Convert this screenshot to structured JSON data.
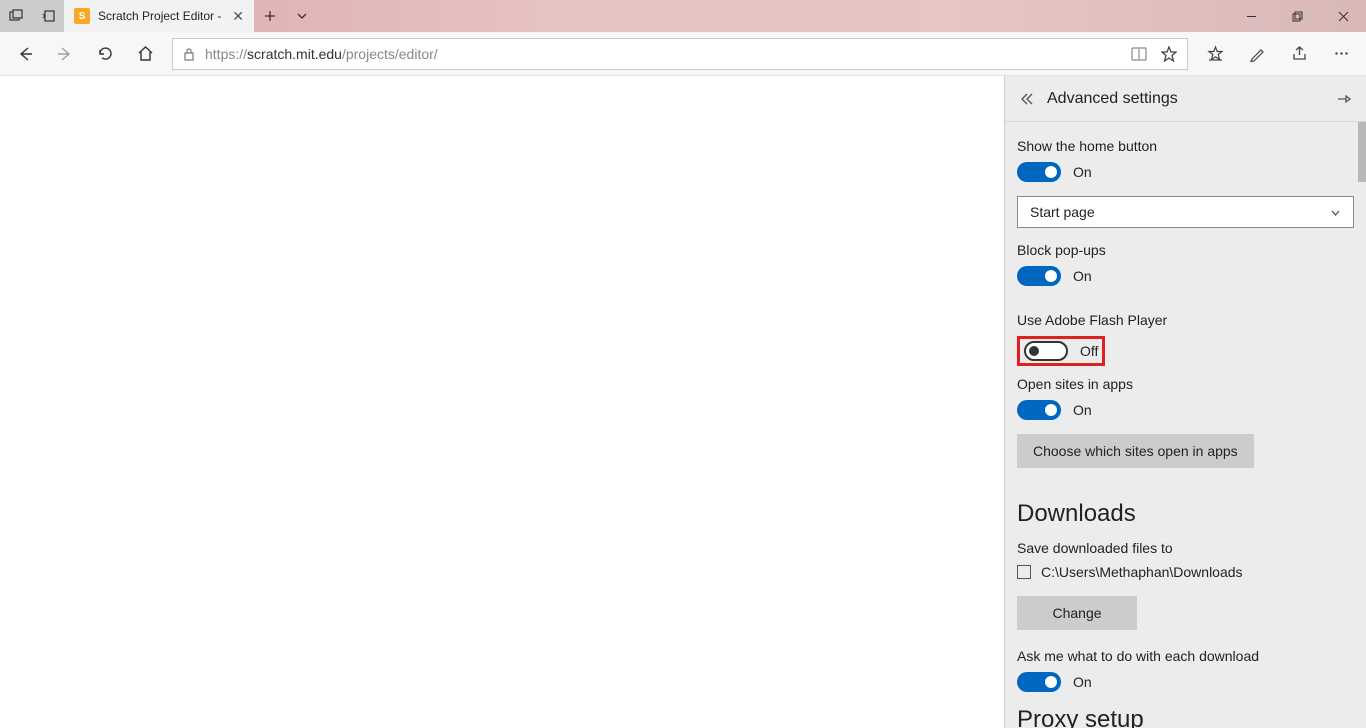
{
  "tab": {
    "title": "Scratch Project Editor -",
    "favicon_letter": "S"
  },
  "address": {
    "prefix": "https://",
    "domain": "scratch.mit.edu",
    "path": "/projects/editor/"
  },
  "panel": {
    "title": "Advanced settings",
    "home_button": {
      "label": "Show the home button",
      "state": "On"
    },
    "home_dropdown": {
      "selected": "Start page"
    },
    "block_popups": {
      "label": "Block pop-ups",
      "state": "On"
    },
    "flash": {
      "label": "Use Adobe Flash Player",
      "state": "Off"
    },
    "open_sites": {
      "label": "Open sites in apps",
      "state": "On"
    },
    "choose_sites_btn": "Choose which sites open in apps",
    "downloads": {
      "heading": "Downloads",
      "save_label": "Save downloaded files to",
      "path": "C:\\Users\\Methaphan\\Downloads",
      "change_btn": "Change"
    },
    "ask_download": {
      "label": "Ask me what to do with each download",
      "state": "On"
    },
    "proxy": {
      "heading": "Proxy setup"
    }
  }
}
